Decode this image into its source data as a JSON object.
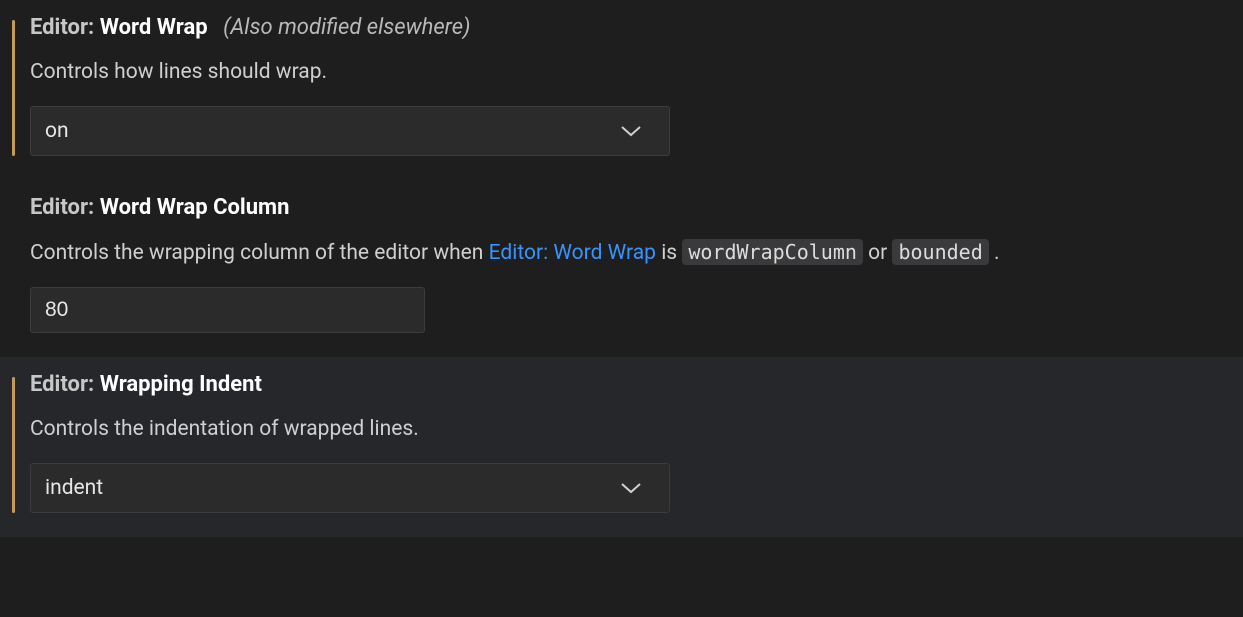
{
  "settings": {
    "wordWrap": {
      "category": "Editor:",
      "name": "Word Wrap",
      "note": "(Also modified elsewhere)",
      "description": "Controls how lines should wrap.",
      "value": "on"
    },
    "wordWrapColumn": {
      "category": "Editor:",
      "name": "Word Wrap Column",
      "desc_pre": "Controls the wrapping column of the editor when ",
      "desc_link": "Editor: Word Wrap",
      "desc_mid1": " is ",
      "desc_code1": "wordWrapColumn",
      "desc_mid2": " or ",
      "desc_code2": "bounded",
      "desc_post": ".",
      "value": "80"
    },
    "wrappingIndent": {
      "category": "Editor:",
      "name": "Wrapping Indent",
      "description": "Controls the indentation of wrapped lines.",
      "value": "indent"
    }
  }
}
